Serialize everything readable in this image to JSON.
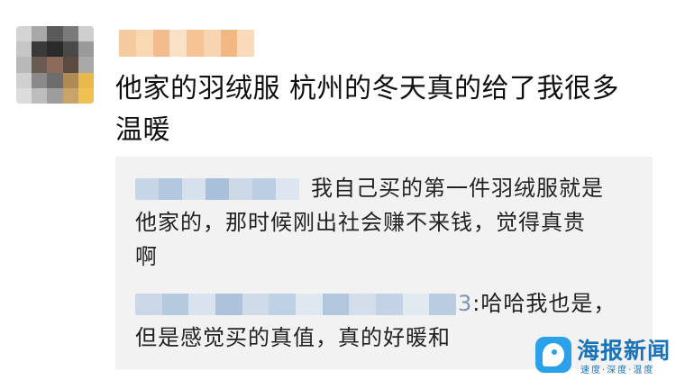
{
  "comment": {
    "line1": "他家的羽绒服 杭州的冬天真的给了我很多",
    "line2": "温暖"
  },
  "quoted_replies": [
    {
      "line1": "我自己买的第一件羽绒服就是",
      "line2": "他家的，那时候刚出社会赚不来钱，觉得真贵",
      "line3": "啊"
    },
    {
      "name_suffix": "3",
      "line1": ":哈哈我也是，",
      "line2": "但是感觉买的真值，真的好暖和"
    }
  ],
  "watermark": {
    "name": "海报新闻",
    "slogan": "速度·深度·温度"
  },
  "colors": {
    "quote_background": "#f2f2f2",
    "logo_blue": "#2aa1e8",
    "logo_text": "#1a73b8"
  }
}
